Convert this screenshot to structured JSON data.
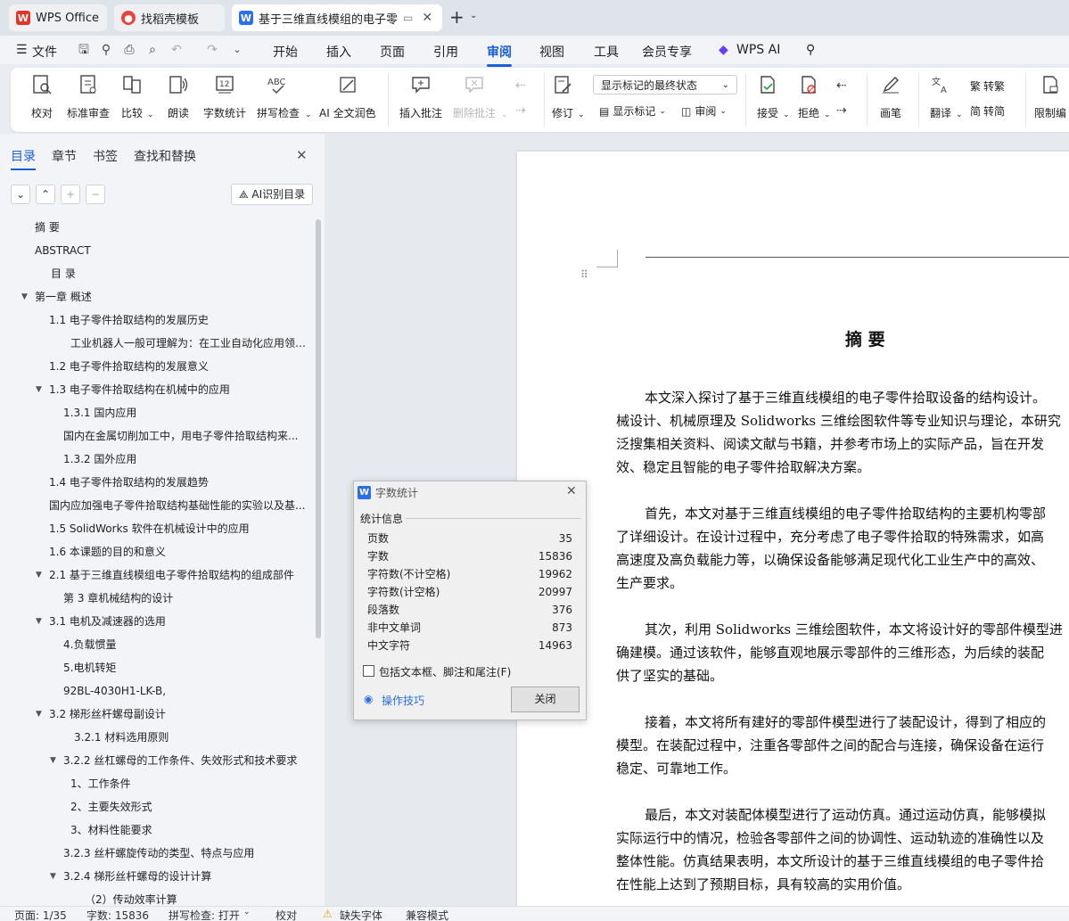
{
  "tabs": [
    {
      "label": "WPS Office",
      "icon": "wps-logo-icon"
    },
    {
      "label": "找稻壳模板",
      "icon": "docer-icon"
    },
    {
      "label": "基于三维直线模组的电子零件",
      "icon": "word-doc-icon"
    }
  ],
  "menu": {
    "file": "文件",
    "items": [
      "开始",
      "插入",
      "页面",
      "引用",
      "审阅",
      "视图",
      "工具",
      "会员专享"
    ],
    "active": "审阅",
    "ai": "WPS AI"
  },
  "ribbon": {
    "proofread": "校对",
    "standard_review": "标准审查",
    "compare": "比较",
    "read_aloud": "朗读",
    "word_count": "字数统计",
    "spell_check": "拼写检查",
    "ai_proofread": "AI 全文润色",
    "insert_comment": "插入批注",
    "delete_comment": "删除批注",
    "revise": "修订",
    "markup_select": "显示标记的最终状态",
    "show_markup": "显示标记",
    "review": "审阅",
    "accept": "接受",
    "reject": "拒绝",
    "pen": "画笔",
    "translate": "翻译",
    "to_traditional": "转繁",
    "to_simplified": "转简",
    "restrict_edit": "限制编"
  },
  "nav": {
    "tabs": [
      "目录",
      "章节",
      "书签",
      "查找和替换"
    ],
    "ai_button": "AI识别目录",
    "toc": [
      {
        "text": "摘 要",
        "level": 0,
        "arrow": ""
      },
      {
        "text": "ABSTRACT",
        "level": 0,
        "arrow": ""
      },
      {
        "text": "目 录",
        "level": 1,
        "arrow": ""
      },
      {
        "text": "第一章 概述",
        "level": 0,
        "arrow": "down"
      },
      {
        "text": "1.1 电子零件拾取结构的发展历史",
        "level": 1,
        "arrow": ""
      },
      {
        "text": "工业机器人一般可理解为：在工业自动化应用领域...",
        "level": 3,
        "arrow": ""
      },
      {
        "text": "1.2 电子零件拾取结构的发展意义",
        "level": 1,
        "arrow": ""
      },
      {
        "text": "1.3 电子零件拾取结构在机械中的应用",
        "level": 1,
        "arrow": "down"
      },
      {
        "text": "1.3.1 国内应用",
        "level": 2,
        "arrow": ""
      },
      {
        "text": "国内在金属切削加工中，用电子零件拾取结构来...",
        "level": 2,
        "arrow": ""
      },
      {
        "text": "1.3.2 国外应用",
        "level": 2,
        "arrow": ""
      },
      {
        "text": "1.4 电子零件拾取结构的发展趋势",
        "level": 1,
        "arrow": ""
      },
      {
        "text": "国内应加强电子零件拾取结构基础性能的实验以及基...",
        "level": 1,
        "arrow": ""
      },
      {
        "text": "1.5 SolidWorks 软件在机械设计中的应用",
        "level": 1,
        "arrow": ""
      },
      {
        "text": "1.6 本课题的目的和意义",
        "level": 1,
        "arrow": ""
      },
      {
        "text": "2.1 基于三维直线模组电子零件拾取结构的组成部件",
        "level": 1,
        "arrow": "down"
      },
      {
        "text": "第 3 章机械结构的设计",
        "level": 2,
        "arrow": ""
      },
      {
        "text": "3.1 电机及减速器的选用",
        "level": 1,
        "arrow": "down"
      },
      {
        "text": "4.负载惯量",
        "level": 2,
        "arrow": ""
      },
      {
        "text": "5.电机转矩",
        "level": 2,
        "arrow": ""
      },
      {
        "text": "92BL-4030H1-LK-B,",
        "level": 2,
        "arrow": ""
      },
      {
        "text": "3.2 梯形丝杆螺母副设计",
        "level": 1,
        "arrow": "down"
      },
      {
        "text": "3.2.1 材料选用原则",
        "level": 3,
        "arrow": ""
      },
      {
        "text": "3.2.2 丝杠螺母的工作条件、失效形式和技术要求",
        "level": 2,
        "arrow": "down"
      },
      {
        "text": "1、工作条件",
        "level": 3,
        "arrow": ""
      },
      {
        "text": "2、主要失效形式",
        "level": 3,
        "arrow": ""
      },
      {
        "text": "3、材料性能要求",
        "level": 3,
        "arrow": ""
      },
      {
        "text": "3.2.3 丝杆螺旋传动的类型、特点与应用",
        "level": 2,
        "arrow": ""
      },
      {
        "text": "3.2.4 梯形丝杆螺母的设计计算",
        "level": 2,
        "arrow": "down"
      },
      {
        "text": "（2）传动效率计算",
        "level": 3,
        "arrow": ""
      }
    ]
  },
  "document": {
    "heading": "摘 要",
    "lines": [
      "本文深入探讨了基于三维直线模组的电子零件拾取设备的结构设计。",
      "械设计、机械原理及 Solidworks 三维绘图软件等专业知识与理论，本研究",
      "泛搜集相关资料、阅读文献与书籍，并参考市场上的实际产品，旨在开发",
      "效、稳定且智能的电子零件拾取解决方案。",
      "",
      "首先，本文对基于三维直线模组的电子零件拾取结构的主要机构零部",
      "了详细设计。在设计过程中，充分考虑了电子零件拾取的特殊需求，如高",
      "高速度及高负载能力等，以确保设备能够满足现代化工业生产中的高效、",
      "生产要求。",
      "",
      "其次，利用 Solidworks 三维绘图软件，本文将设计好的零部件模型进",
      "确建模。通过该软件，能够直观地展示零部件的三维形态，为后续的装配",
      "供了坚实的基础。",
      "",
      "接着，本文将所有建好的零部件模型进行了装配设计，得到了相应的",
      "模型。在装配过程中，注重各零部件之间的配合与连接，确保设备在运行",
      "稳定、可靠地工作。",
      "",
      "最后，本文对装配体模型进行了运动仿真。通过运动仿真，能够模拟",
      "实际运行中的情况，检验各零部件之间的协调性、运动轨迹的准确性以及",
      "整体性能。仿真结果表明，本文所设计的基于三维直线模组的电子零件拾",
      "在性能上达到了预期目标，具有较高的实用价值。"
    ]
  },
  "dialog": {
    "title": "字数统计",
    "group": "统计信息",
    "stats": [
      {
        "label": "页数",
        "value": "35"
      },
      {
        "label": "字数",
        "value": "15836"
      },
      {
        "label": "字符数(不计空格)",
        "value": "19962"
      },
      {
        "label": "字符数(计空格)",
        "value": "20997"
      },
      {
        "label": "段落数",
        "value": "376"
      },
      {
        "label": "非中文单词",
        "value": "873"
      },
      {
        "label": "中文字符",
        "value": "14963"
      }
    ],
    "checkbox": "包括文本框、脚注和尾注(F)",
    "tips": "操作技巧",
    "close": "关闭"
  },
  "status": {
    "page": "页面: 1/35",
    "words": "字数: 15836",
    "spell": "拼写检查: 打开",
    "proof": "校对",
    "missing_font": "缺失字体",
    "compat": "兼容模式"
  },
  "colors": {
    "accent": "#1a5fd8",
    "wps_red": "#e5332a",
    "word_blue": "#2a6ee8"
  }
}
